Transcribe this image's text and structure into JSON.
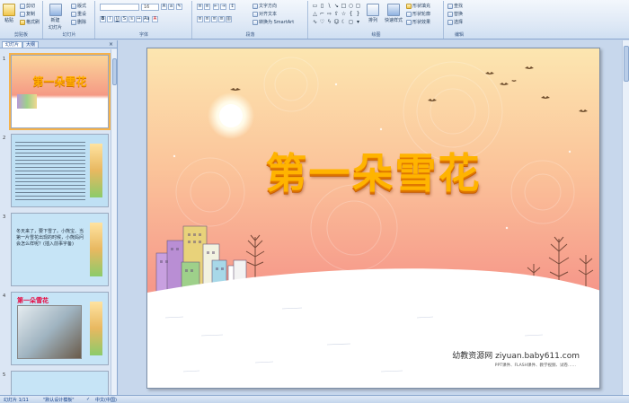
{
  "ribbon": {
    "clipboard": {
      "paste": "粘贴",
      "cut": "剪切",
      "copy": "复制",
      "format_painter": "格式刷",
      "label": "剪贴板"
    },
    "slides": {
      "new_slide": "新建",
      "new_slide_2": "幻灯片",
      "layout": "版式",
      "reset": "重设",
      "delete": "删除",
      "label": "幻灯片"
    },
    "font": {
      "font_name": "",
      "font_size": "16",
      "label": "字体"
    },
    "paragraph": {
      "text_direction": "文字方向",
      "align_text": "对齐文本",
      "convert_smartart": "转换为 SmartArt",
      "label": "段落"
    },
    "drawing": {
      "arrange": "排列",
      "quick_styles": "快速样式",
      "shape_fill": "形状填充",
      "shape_outline": "形状轮廓",
      "shape_effects": "形状效果",
      "label": "绘图"
    },
    "editing": {
      "find": "查找",
      "replace": "替换",
      "select": "选择",
      "label": "编辑"
    }
  },
  "panel": {
    "tab_slides": "幻灯片",
    "tab_outline": "大纲",
    "close": "×"
  },
  "thumbnails": [
    {
      "num": "1",
      "title": "第一朵雪花"
    },
    {
      "num": "2",
      "title": ""
    },
    {
      "num": "3",
      "title": "",
      "text": "冬天来了，要下雪了。小熊宝、当第一片雪花出现的时候，小熊妈问会怎么样呢？(插入前事字备)"
    },
    {
      "num": "4",
      "title": "第一朵雪花"
    },
    {
      "num": "5",
      "title": ""
    }
  ],
  "slide": {
    "title": "第一朵雪花",
    "watermark": "幼教资源网 ziyuan.baby611.com",
    "watermark_sub": "PPT课件、FLASH课件、教学视频、试卷……"
  },
  "status": {
    "slide_count": "幻灯片 1/11",
    "theme": "\"默认设计模板\"",
    "language": "中文(中国)"
  }
}
